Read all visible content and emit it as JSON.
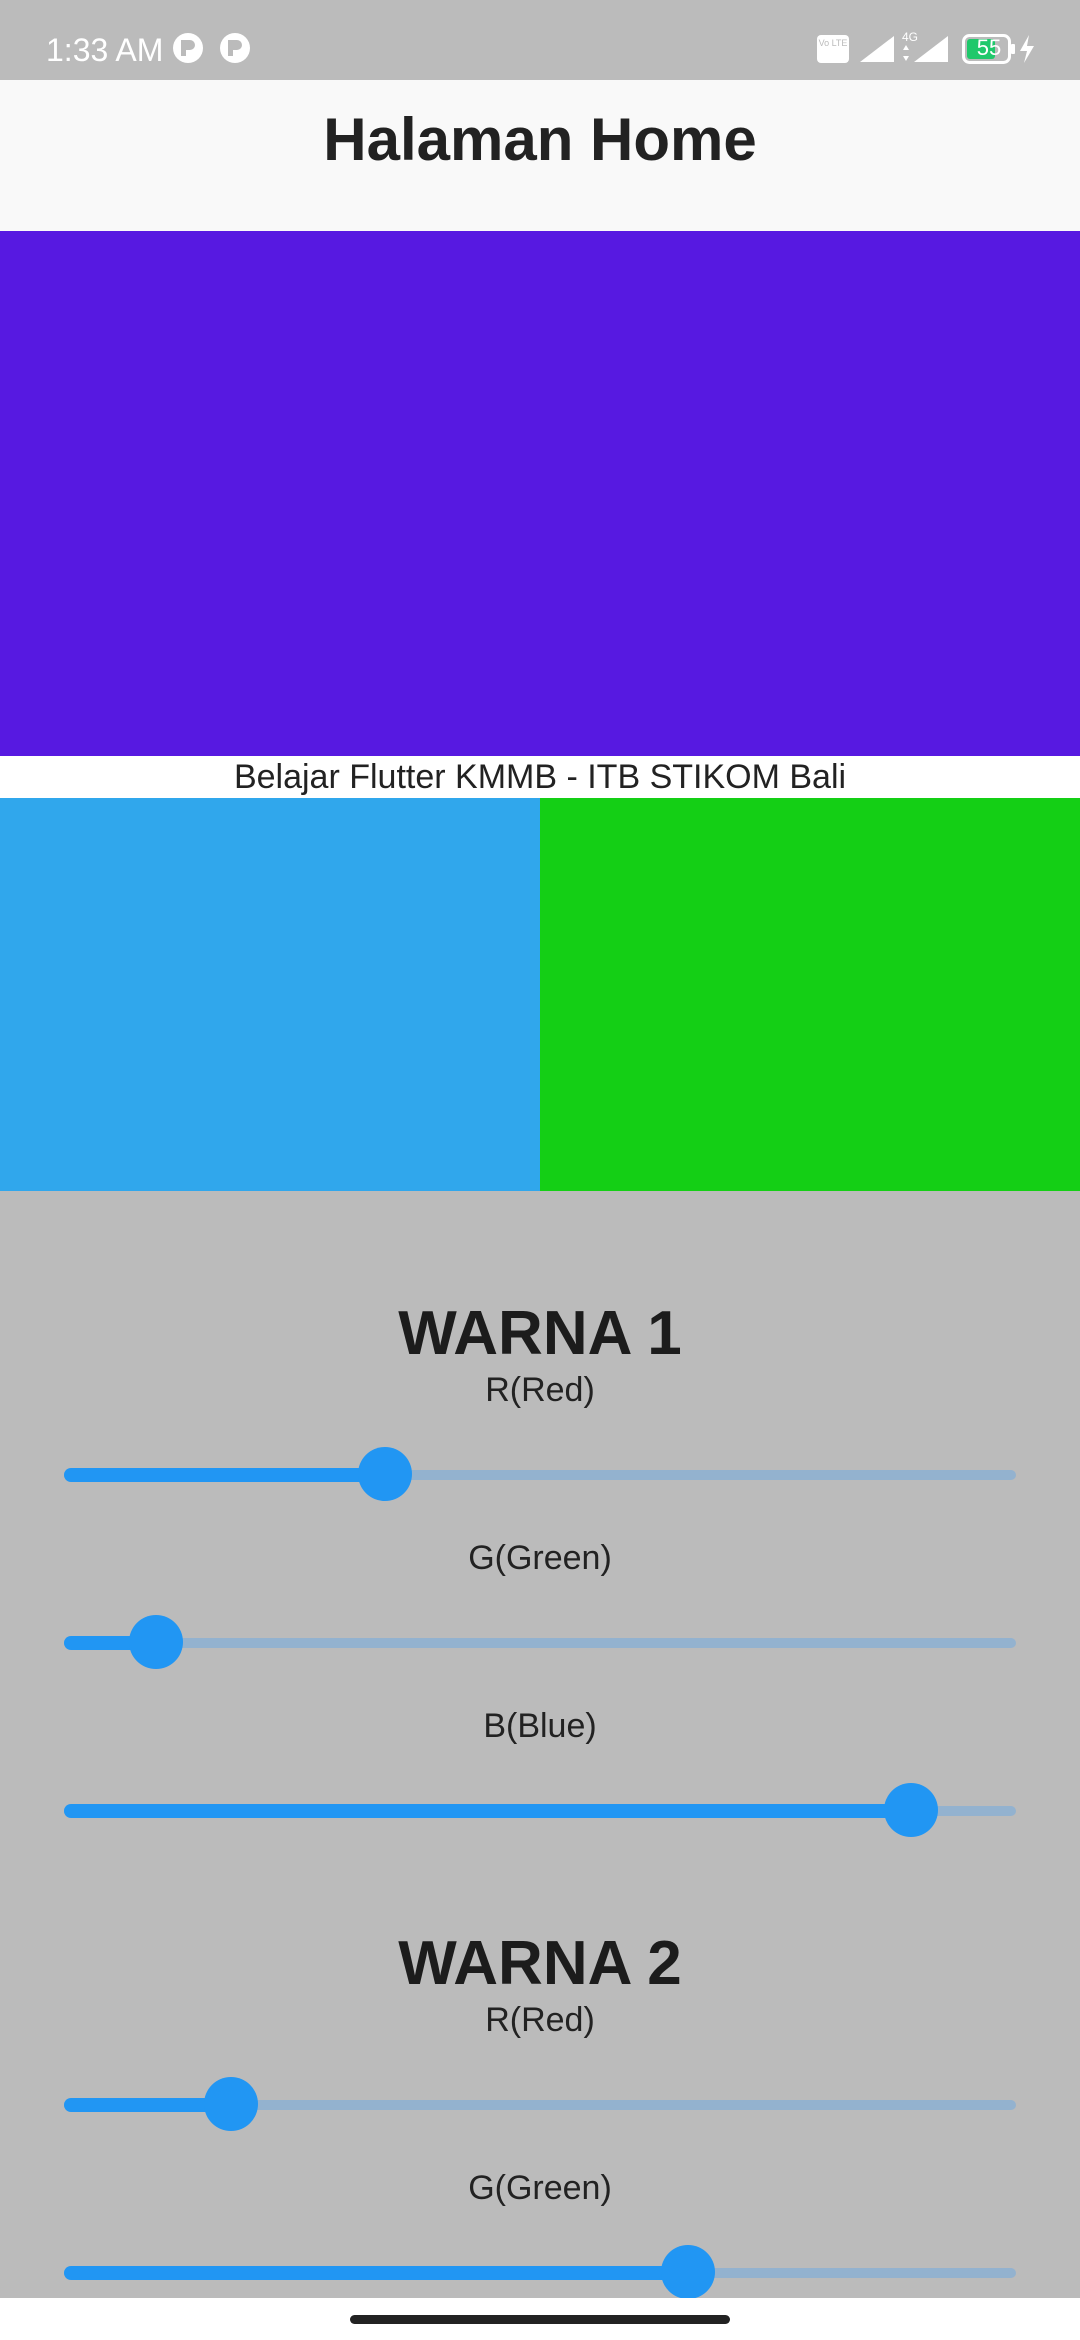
{
  "status_bar": {
    "time": "1:33 AM",
    "battery_level": "55",
    "network_label": "4G",
    "volte_label": "Vo LTE",
    "icons": [
      "app-notification-icon",
      "app-notification-icon",
      "volte-icon",
      "signal-icon",
      "signal-4g-icon",
      "battery-icon",
      "charging-icon"
    ]
  },
  "app_bar": {
    "title": "Halaman Home"
  },
  "preview": {
    "main_color": "#5719e1",
    "caption": "Belajar Flutter KMMB - ITB STIKOM Bali",
    "left_color": "#30a7ec",
    "right_color": "#14cf15"
  },
  "controls": {
    "warna1": {
      "heading": "WARNA 1",
      "sliders": [
        {
          "label": "R(Red)",
          "value": 0.337
        },
        {
          "label": "G(Green)",
          "value": 0.097
        },
        {
          "label": "B(Blue)",
          "value": 0.89
        }
      ]
    },
    "warna2": {
      "heading": "WARNA 2",
      "sliders": [
        {
          "label": "R(Red)",
          "value": 0.175
        },
        {
          "label": "G(Green)",
          "value": 0.655
        }
      ]
    }
  },
  "colors": {
    "accent": "#2196f3",
    "track_inactive": "#93b2cf",
    "background": "#bbbbbb"
  }
}
